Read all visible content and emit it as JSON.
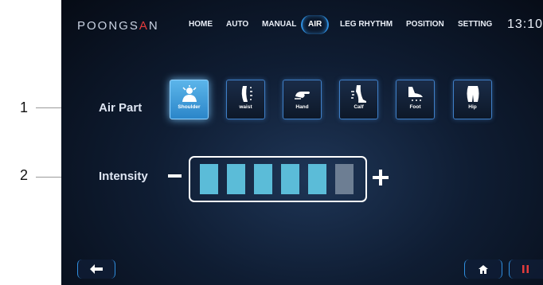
{
  "callouts": {
    "one": "1",
    "two": "2"
  },
  "brand": {
    "logo_main": "POONGS",
    "logo_accent": "A",
    "logo_end": "N"
  },
  "nav": {
    "items": [
      "HOME",
      "AUTO",
      "MANUAL",
      "AIR",
      "LEG RHYTHM",
      "POSITION",
      "SETTING"
    ],
    "active": "AIR"
  },
  "clock": "13:10",
  "air_part": {
    "label": "Air Part",
    "parts": [
      {
        "label": "Shoulder",
        "icon": "shoulder-icon",
        "selected": true
      },
      {
        "label": "waist",
        "icon": "waist-icon",
        "selected": false
      },
      {
        "label": "Hand",
        "icon": "hand-icon",
        "selected": false
      },
      {
        "label": "Calf",
        "icon": "calf-icon",
        "selected": false
      },
      {
        "label": "Foot",
        "icon": "foot-icon",
        "selected": false
      },
      {
        "label": "Hip",
        "icon": "hip-icon",
        "selected": false
      }
    ]
  },
  "intensity": {
    "label": "Intensity",
    "level": 5,
    "max": 6
  },
  "footer": {
    "back_icon": "back-arrow-icon",
    "home_icon": "home-icon",
    "pause_icon": "pause-icon"
  },
  "colors": {
    "accent": "#2f8fe0",
    "level_on": "#5bbcd8",
    "level_off": "#6d7e93",
    "pause": "#e53c3c"
  }
}
